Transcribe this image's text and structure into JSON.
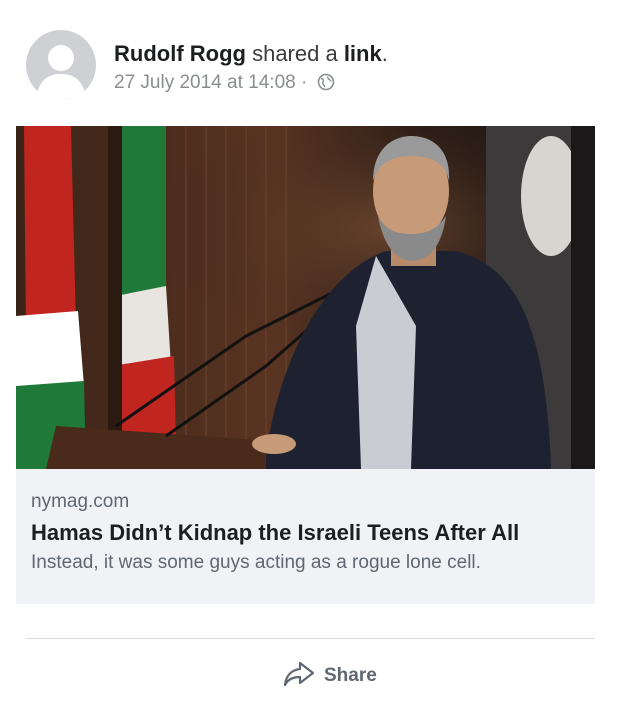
{
  "post": {
    "actor_name": "Rudolf Rogg",
    "action_text": " shared a ",
    "action_object": "link",
    "action_end": ".",
    "timestamp": "27 July 2014 at 14:08",
    "separator": " · ",
    "privacy_icon": "globe-icon"
  },
  "link_card": {
    "image_icon": "press-photo-speaker-at-podium",
    "domain": "nymag.com",
    "headline": "Hamas Didn’t Kidnap the Israeli Teens After All",
    "description": "Instead, it was some guys acting as a rogue lone cell."
  },
  "actions": {
    "share_label": "Share",
    "share_icon": "share-arrow-icon"
  },
  "colors": {
    "card_background": "#f0f2f5",
    "muted_text": "#606770",
    "avatar_gray": "#ced0d4"
  }
}
